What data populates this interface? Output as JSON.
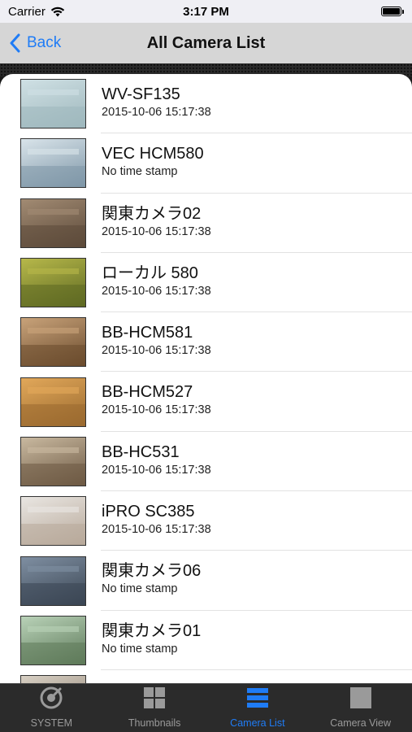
{
  "status_bar": {
    "carrier": "Carrier",
    "time": "3:17 PM"
  },
  "nav": {
    "back_label": "Back",
    "title": "All Camera List"
  },
  "cameras": [
    {
      "name": "WV-SF135",
      "timestamp": "2015-10-06 15:17:38",
      "thumb_colors": [
        "#cfe0e4",
        "#9fb8bd"
      ]
    },
    {
      "name": "VEC HCM580",
      "timestamp": "No time stamp",
      "thumb_colors": [
        "#d9e4ea",
        "#7f97a8"
      ]
    },
    {
      "name": "関東カメラ02",
      "timestamp": "2015-10-06 15:17:38",
      "thumb_colors": [
        "#a28b73",
        "#5c4a3a"
      ]
    },
    {
      "name": "ローカル 580",
      "timestamp": "2015-10-06 15:17:38",
      "thumb_colors": [
        "#b7b84a",
        "#5f6a23"
      ]
    },
    {
      "name": "BB-HCM581",
      "timestamp": "2015-10-06 15:17:38",
      "thumb_colors": [
        "#c9a37a",
        "#6b4c2e"
      ]
    },
    {
      "name": "BB-HCM527",
      "timestamp": "2015-10-06 15:17:38",
      "thumb_colors": [
        "#e2a85a",
        "#9a6a2f"
      ]
    },
    {
      "name": "BB-HC531",
      "timestamp": "2015-10-06 15:17:38",
      "thumb_colors": [
        "#c9b9a0",
        "#6e5a44"
      ]
    },
    {
      "name": "iPRO SC385",
      "timestamp": "2015-10-06 15:17:38",
      "thumb_colors": [
        "#e9e6e2",
        "#b8a99a"
      ]
    },
    {
      "name": "関東カメラ06",
      "timestamp": "No time stamp",
      "thumb_colors": [
        "#7f8fa2",
        "#3b4653"
      ]
    },
    {
      "name": "関東カメラ01",
      "timestamp": "No time stamp",
      "thumb_colors": [
        "#b9d2b8",
        "#5e7a5a"
      ]
    }
  ],
  "tabs": [
    {
      "label": "SYSTEM",
      "icon": "system-icon",
      "active": false
    },
    {
      "label": "Thumbnails",
      "icon": "thumbnails-icon",
      "active": false
    },
    {
      "label": "Camera List",
      "icon": "camera-list-icon",
      "active": true
    },
    {
      "label": "Camera View",
      "icon": "camera-view-icon",
      "active": false
    }
  ],
  "colors": {
    "accent": "#1f7cf6",
    "tab_inactive": "#9a9a9a",
    "tab_bar_bg": "#2b2b2b"
  }
}
